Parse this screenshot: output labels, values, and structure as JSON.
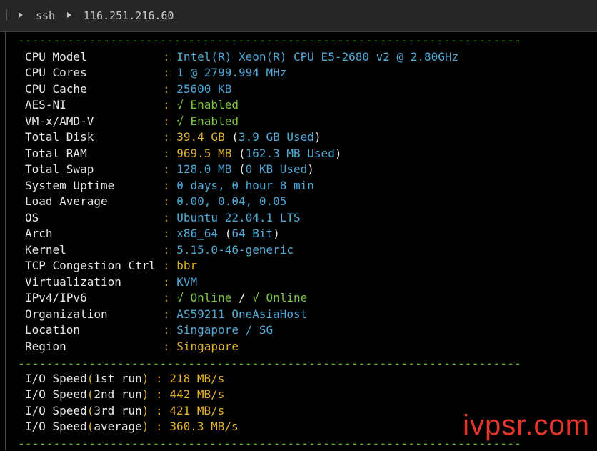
{
  "tabbar": {
    "items": [
      "ssh",
      "116.251.216.60"
    ]
  },
  "separator": "-----------------------------------------------------------------------",
  "sysinfo": {
    "cpu_model": {
      "label": "CPU Model",
      "value": "Intel(R) Xeon(R) CPU E5-2680 v2 @ 2.80GHz"
    },
    "cpu_cores": {
      "label": "CPU Cores",
      "value": "1 @ 2799.994 MHz"
    },
    "cpu_cache": {
      "label": "CPU Cache",
      "value": "25600 KB"
    },
    "aes_ni": {
      "label": "AES-NI",
      "value": "√ Enabled"
    },
    "vm_x": {
      "label": "VM-x/AMD-V",
      "value": "√ Enabled"
    },
    "total_disk": {
      "label": "Total Disk",
      "value": "39.4 GB",
      "extra": "3.9 GB Used"
    },
    "total_ram": {
      "label": "Total RAM",
      "value": "969.5 MB",
      "extra": "162.3 MB Used"
    },
    "total_swap": {
      "label": "Total Swap",
      "value": "128.0 MB",
      "extra": "0 KB Used"
    },
    "uptime": {
      "label": "System Uptime",
      "value": "0 days, 0 hour 8 min"
    },
    "load": {
      "label": "Load Average",
      "value": "0.00, 0.04, 0.05"
    },
    "os": {
      "label": "OS",
      "value": "Ubuntu 22.04.1 LTS"
    },
    "arch": {
      "label": "Arch",
      "value": "x86_64",
      "extra": "64 Bit"
    },
    "kernel": {
      "label": "Kernel",
      "value": "5.15.0-46-generic"
    },
    "tcp": {
      "label": "TCP Congestion Ctrl",
      "value": "bbr"
    },
    "virt": {
      "label": "Virtualization",
      "value": "KVM"
    },
    "ipv": {
      "label": "IPv4/IPv6",
      "value4": "√ Online",
      "sep": "/",
      "value6": "√ Online"
    },
    "org": {
      "label": "Organization",
      "value": "AS59211 OneAsiaHost"
    },
    "location": {
      "label": "Location",
      "value": "Singapore / SG"
    },
    "region": {
      "label": "Region",
      "value": "Singapore"
    }
  },
  "io": {
    "run1": {
      "label": "I/O Speed",
      "paren": "1st run",
      "value": "218 MB/s"
    },
    "run2": {
      "label": "I/O Speed",
      "paren": "2nd run",
      "value": "442 MB/s"
    },
    "run3": {
      "label": "I/O Speed",
      "paren": "3rd run",
      "value": "421 MB/s"
    },
    "avg": {
      "label": "I/O Speed",
      "paren": "average",
      "value": "360.3 MB/s"
    }
  },
  "watermark": "ivpsr.com",
  "colors": {
    "background": "#000000",
    "separator": "#66c01f",
    "label": "#e8e8e8",
    "colon": "#e1b12c",
    "blue": "#4fa8d6",
    "green": "#7cc243",
    "yellow": "#e1b12c"
  }
}
